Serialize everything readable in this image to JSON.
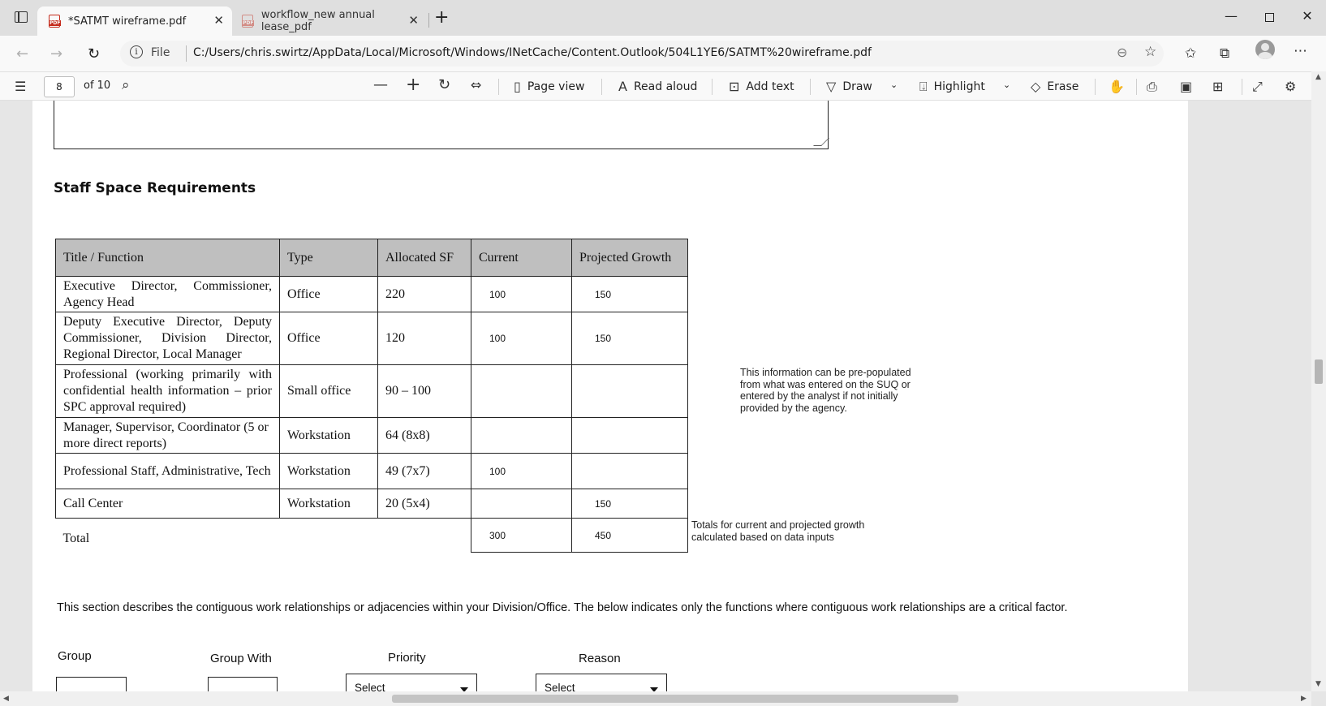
{
  "browser": {
    "tabs": [
      {
        "title": "*SATMT wireframe.pdf",
        "active": true
      },
      {
        "title": "workflow_new annual lease_pdf",
        "active": false
      }
    ],
    "new_tab_icon": "plus-icon",
    "address": {
      "scheme_label": "File",
      "url": "C:/Users/chris.swirtz/AppData/Local/Microsoft/Windows/INetCache/Content.Outlook/504L1YE6/SATMT%20wireframe.pdf"
    }
  },
  "pdf_toolbar": {
    "page_number": "8",
    "page_count": "of 10",
    "page_view": "Page view",
    "read_aloud": "Read aloud",
    "add_text": "Add text",
    "draw": "Draw",
    "highlight": "Highlight",
    "erase": "Erase"
  },
  "document": {
    "section_title": "Staff Space Requirements",
    "table": {
      "headers": [
        "Title / Function",
        "Type",
        "Allocated SF",
        "Current",
        "Projected Growth"
      ],
      "rows": [
        {
          "title": "Executive Director, Commissioner, Agency Head",
          "type": "Office",
          "sf": "220",
          "current": "100",
          "growth": "150"
        },
        {
          "title": "Deputy Executive Director, Deputy Commissioner, Division Director, Regional Director, Local Manager",
          "type": "Office",
          "sf": "120",
          "current": "100",
          "growth": "150"
        },
        {
          "title": "Professional (working primarily with confidential health information – prior SPC approval required)",
          "type": "Small office",
          "sf": "90 – 100",
          "current": "",
          "growth": ""
        },
        {
          "title": "Manager, Supervisor, Coordinator (5 or more direct reports)",
          "type": "Workstation",
          "sf": "64 (8x8)",
          "current": "",
          "growth": ""
        },
        {
          "title": "Professional Staff, Administrative, Tech",
          "type": "Workstation",
          "sf": "49 (7x7)",
          "current": "100",
          "growth": ""
        },
        {
          "title": "Call Center",
          "type": "Workstation",
          "sf": "20 (5x4)",
          "current": "",
          "growth": "150"
        }
      ],
      "total_label": "Total",
      "total_current": "300",
      "total_growth": "450"
    },
    "note_prepopulated": "This information can be pre-populated from what was entered on the SUQ or entered by the analyst if not initially provided by the agency.",
    "note_totals": "Totals for current and projected growth calculated based on data inputs",
    "adjacency_description": "This section describes the contiguous work relationships or adjacencies within your Division/Office. The below indicates only the functions where contiguous work relationships are a critical factor.",
    "fields": {
      "group": "Group",
      "group_with": "Group With",
      "priority": "Priority",
      "reason": "Reason",
      "priority_value": "Select",
      "reason_value": "Select"
    }
  }
}
